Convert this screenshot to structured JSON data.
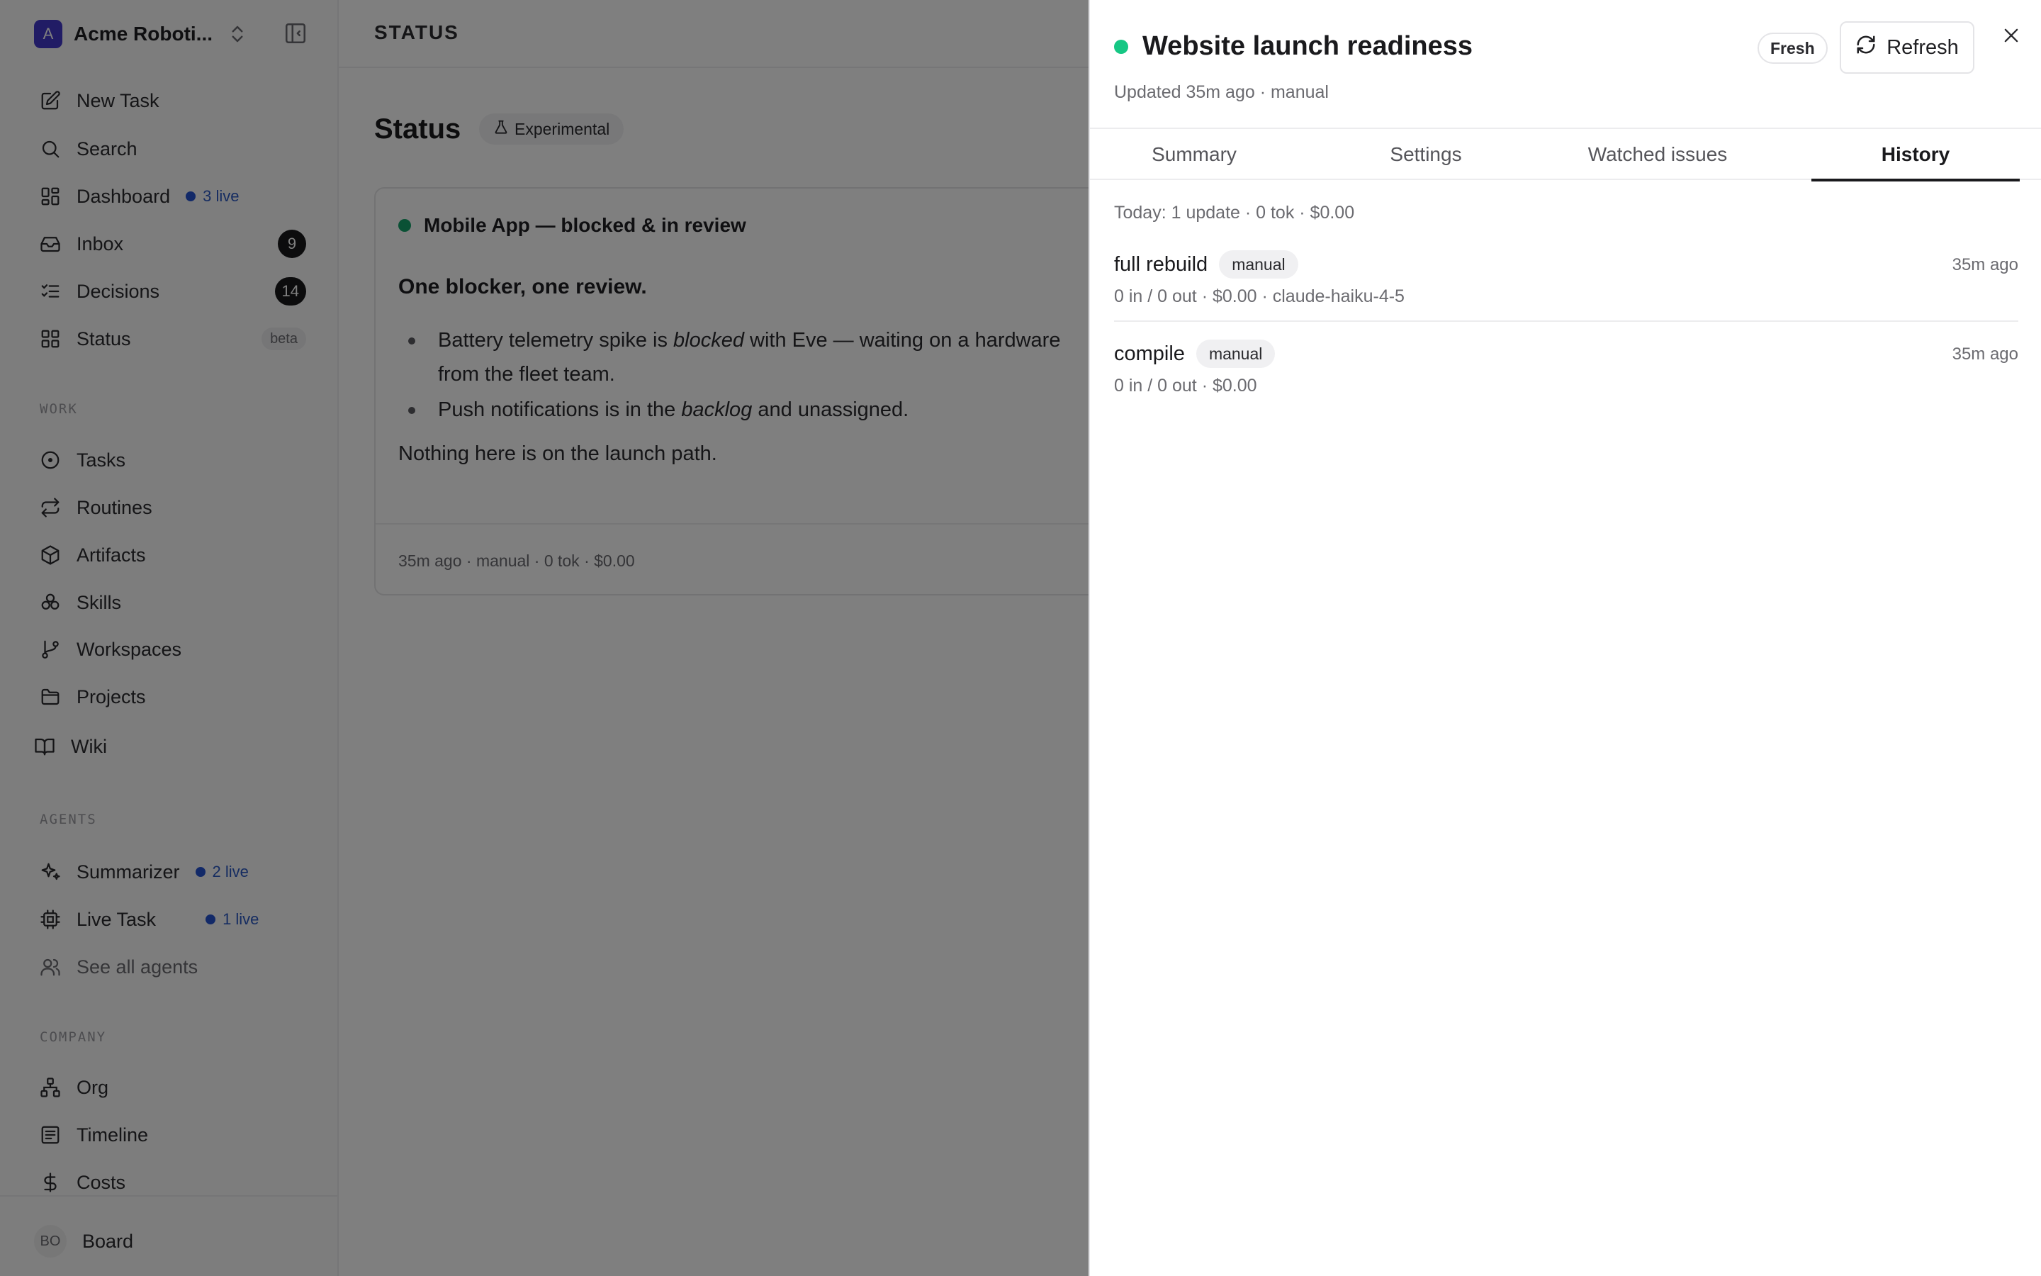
{
  "workspace": {
    "initial": "A",
    "name": "Acme Roboti..."
  },
  "nav": {
    "new_task": "New Task",
    "search": "Search",
    "dashboard": "Dashboard",
    "dashboard_live": "3 live",
    "inbox": "Inbox",
    "inbox_count": "9",
    "decisions": "Decisions",
    "decisions_count": "14",
    "status": "Status",
    "status_badge": "beta"
  },
  "work": {
    "label": "WORK",
    "tasks": "Tasks",
    "routines": "Routines",
    "artifacts": "Artifacts",
    "skills": "Skills",
    "workspaces": "Workspaces",
    "projects": "Projects",
    "wiki": "Wiki"
  },
  "agents": {
    "label": "AGENTS",
    "summarizer": "Summarizer",
    "summarizer_live": "2 live",
    "live_task": "Live Task",
    "live_task_live": "1 live",
    "see_all": "See all agents"
  },
  "company": {
    "label": "COMPANY",
    "org": "Org",
    "timeline": "Timeline",
    "costs": "Costs"
  },
  "user": {
    "initials": "BO",
    "name": "Board"
  },
  "main": {
    "breadcrumb": "STATUS",
    "title": "Status",
    "experimental": "Experimental",
    "card": {
      "title": "Mobile App — blocked & in review",
      "lead": "One blocker, one review.",
      "b1_pre": "Battery telemetry spike is ",
      "b1_em": "blocked",
      "b1_post": " with Eve — waiting on a hardware",
      "b1_wrap": "from the fleet team.",
      "b2_pre": "Push notifications is in the ",
      "b2_em": "backlog",
      "b2_post": " and unassigned.",
      "closing": "Nothing here is on the launch path.",
      "footer": "35m ago · manual · 0 tok · $0.00"
    }
  },
  "drawer": {
    "title": "Website launch readiness",
    "subtitle": "Updated 35m ago · manual",
    "fresh": "Fresh",
    "refresh": "Refresh",
    "tabs": [
      "Summary",
      "Settings",
      "Watched issues",
      "History"
    ],
    "active_tab": "History",
    "history_summary": "Today: 1 update · 0 tok · $0.00",
    "history": [
      {
        "name": "full rebuild",
        "tag": "manual",
        "time": "35m ago",
        "meta": "0 in / 0 out · $0.00 · claude-haiku-4-5"
      },
      {
        "name": "compile",
        "tag": "manual",
        "time": "35m ago",
        "meta": "0 in / 0 out · $0.00"
      }
    ]
  },
  "colors": {
    "accent_live": "#2553d0",
    "status_green": "#16c784",
    "card_green": "#15a36a",
    "workspace_avatar": "#4338ca",
    "overlay": "rgba(0,0,0,0.5)"
  }
}
